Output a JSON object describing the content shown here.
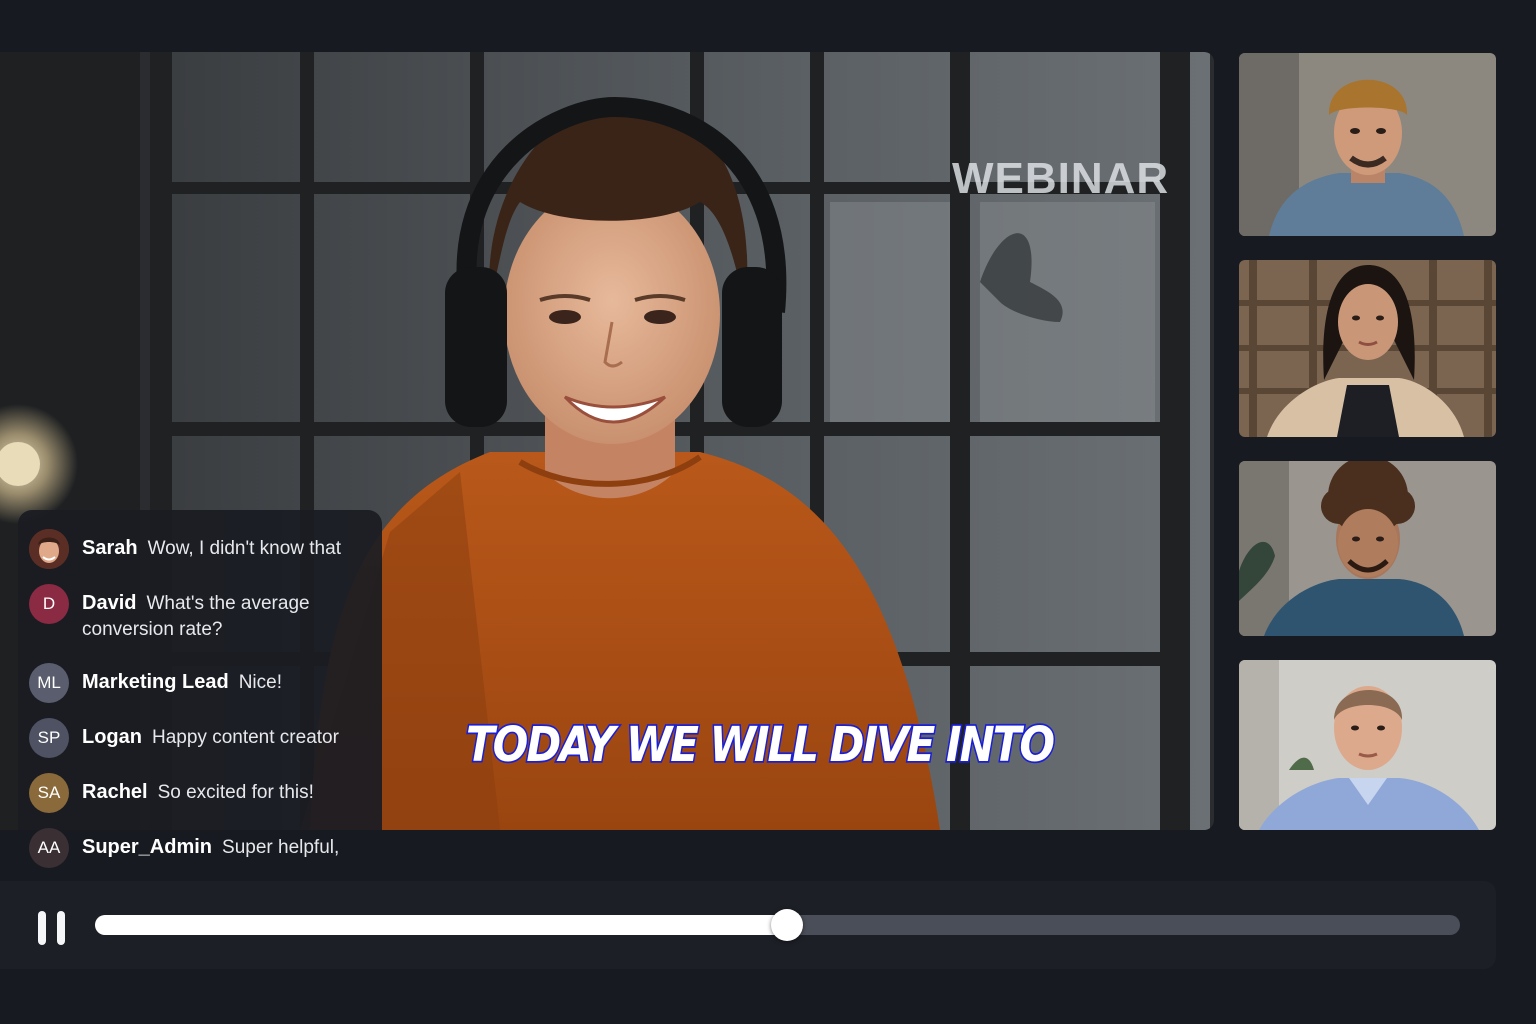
{
  "main_video": {
    "watermark": "WEBINAR",
    "caption": "TODAY WE WILL DIVE INTO"
  },
  "chat": {
    "messages": [
      {
        "user": "Sarah",
        "text": "Wow, I didn't know that",
        "avatar": "photo",
        "avatar_color": "#7a3a2a"
      },
      {
        "user": "David",
        "text": "What's the average conversion rate?",
        "avatar": "D",
        "avatar_color": "#8b2a43"
      },
      {
        "user": "Marketing Lead",
        "text": "Nice!",
        "avatar": "ML",
        "avatar_color": "#5a5d6e"
      },
      {
        "user": "Logan",
        "text": "Happy content creator",
        "avatar": "SP",
        "avatar_color": "#4f5263"
      },
      {
        "user": "Rachel",
        "text": "So excited for this!",
        "avatar": "SA",
        "avatar_color": "#8a6a3a"
      },
      {
        "user": "Super_Admin",
        "text": "Super helpful,",
        "avatar": "AA",
        "avatar_color": "#3a2f33"
      }
    ]
  },
  "participants": [
    {
      "name": "participant-beanie-man"
    },
    {
      "name": "participant-woman-bookshelf"
    },
    {
      "name": "participant-curly-hair-man"
    },
    {
      "name": "participant-man-blue-shirt"
    }
  ],
  "player": {
    "state": "playing",
    "progress": 0.507
  },
  "colors": {
    "background": "#171a20",
    "caption_stroke": "#1a1fd6",
    "track": "#4a4e58",
    "track_fill": "#ffffff"
  }
}
